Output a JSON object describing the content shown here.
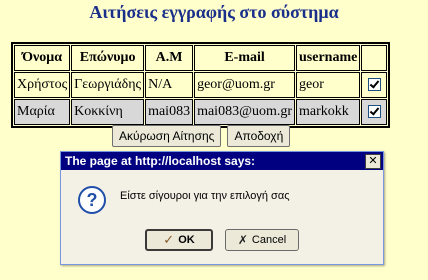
{
  "page": {
    "title": "Αιτήσεις εγγραφής στο σύστημα"
  },
  "table": {
    "headers": [
      "Όνομα",
      "Επώνυμο",
      "Α.Μ",
      "E-mail",
      "username",
      ""
    ],
    "rows": [
      {
        "first": "Χρήστος",
        "last": "Γεωργιάδης",
        "am": "N/A",
        "email": "geor@uom.gr",
        "username": "geor",
        "checked": true
      },
      {
        "first": "Μαρία",
        "last": "Κοκκίνη",
        "am": "mai083",
        "email": "mai083@uom.gr",
        "username": "markokk",
        "checked": true
      }
    ]
  },
  "buttons": {
    "cancel_request": "Ακύρωση Αίτησης",
    "accept": "Αποδοχή"
  },
  "dialog": {
    "title": "The page at http://localhost says:",
    "message": "Είστε σίγουροι για την επιλογή σας",
    "ok_label": "OK",
    "cancel_label": "Cancel",
    "icon": "question-icon"
  }
}
